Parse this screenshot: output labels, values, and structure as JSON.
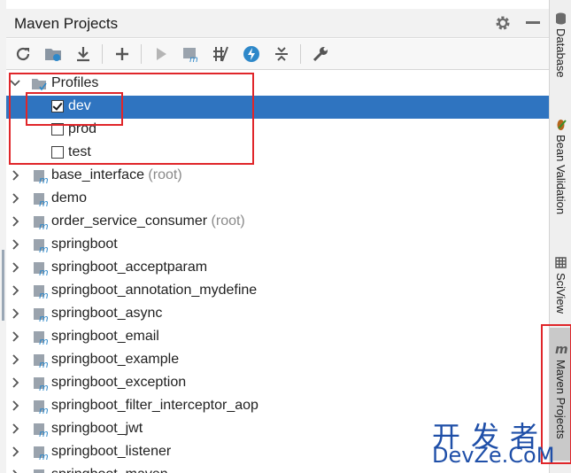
{
  "panel": {
    "title": "Maven Projects"
  },
  "toolbar": {
    "buttons": [
      "reimport-icon",
      "generate-sources-icon",
      "download-icon",
      "add-icon",
      "run-icon",
      "execute-goal-icon",
      "skip-tests-icon",
      "offline-icon",
      "collapse-all-icon",
      "settings-wrench-icon"
    ]
  },
  "tree": {
    "profiles_label": "Profiles",
    "profiles": [
      {
        "name": "dev",
        "checked": true
      },
      {
        "name": "prod",
        "checked": false
      },
      {
        "name": "test",
        "checked": false
      }
    ],
    "projects": [
      {
        "name": "base_interface",
        "suffix": "(root)"
      },
      {
        "name": "demo",
        "suffix": ""
      },
      {
        "name": "order_service_consumer",
        "suffix": "(root)"
      },
      {
        "name": "springboot",
        "suffix": ""
      },
      {
        "name": "springboot_acceptparam",
        "suffix": ""
      },
      {
        "name": "springboot_annotation_mydefine",
        "suffix": ""
      },
      {
        "name": "springboot_async",
        "suffix": ""
      },
      {
        "name": "springboot_email",
        "suffix": ""
      },
      {
        "name": "springboot_example",
        "suffix": ""
      },
      {
        "name": "springboot_exception",
        "suffix": ""
      },
      {
        "name": "springboot_filter_interceptor_aop",
        "suffix": ""
      },
      {
        "name": "springboot_jwt",
        "suffix": ""
      },
      {
        "name": "springboot_listener",
        "suffix": ""
      },
      {
        "name": "springboot_maven",
        "suffix": ""
      }
    ]
  },
  "sidebar": {
    "tabs": [
      "Database",
      "Bean Validation",
      "SciView",
      "Maven Projects"
    ]
  },
  "watermark": {
    "cn": "开发者",
    "en": "DevZe.CoM"
  },
  "colors": {
    "selection": "#2f74c0",
    "annotation": "#e0262a",
    "accent_blue": "#2e88c9"
  }
}
